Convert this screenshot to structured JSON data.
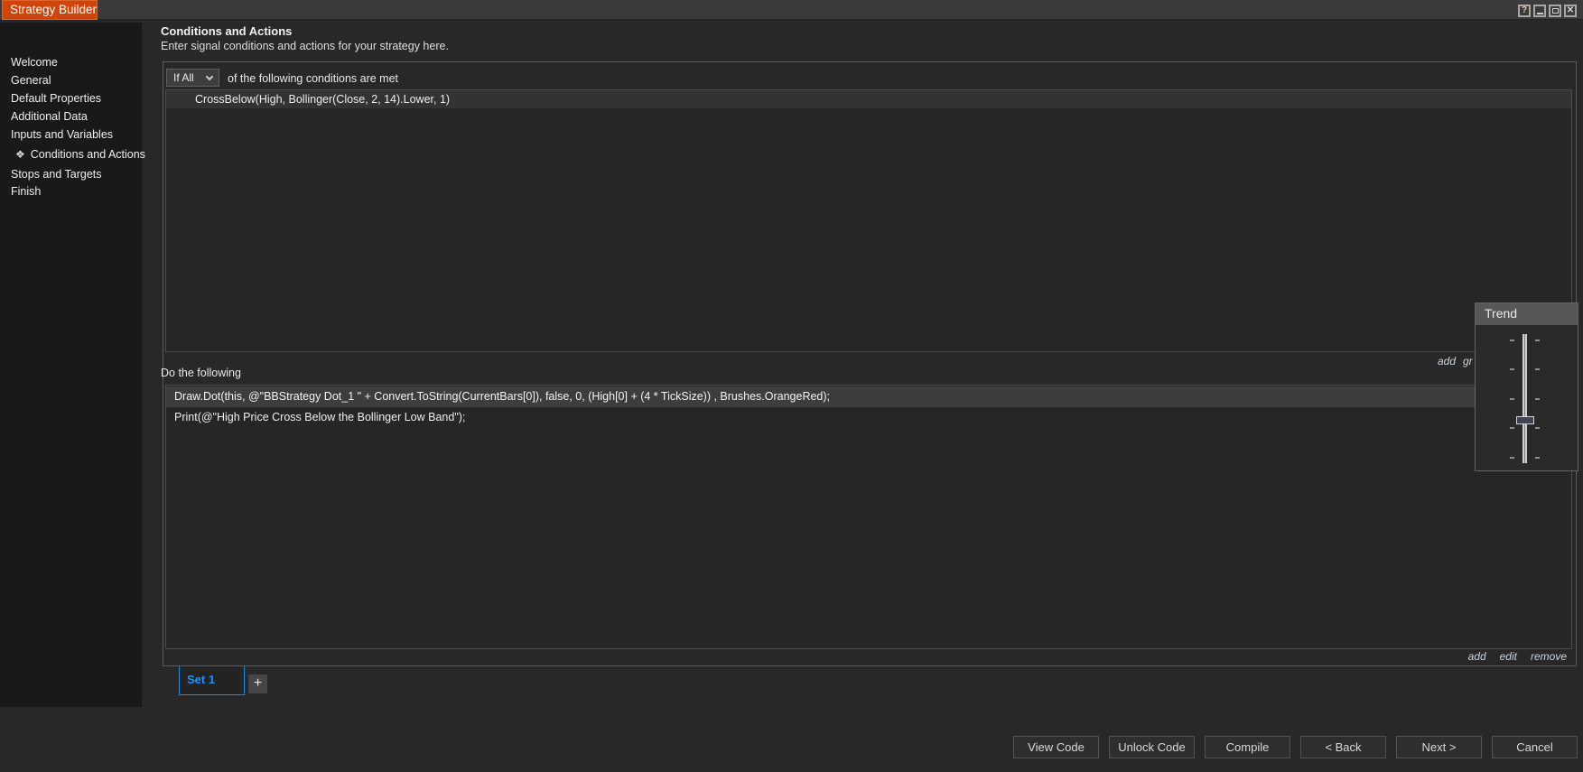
{
  "window": {
    "title": "Strategy Builder",
    "icons": {
      "help": "?",
      "minimize": "—",
      "maximize": "▢",
      "close": "✕"
    }
  },
  "sidebar": {
    "items": [
      {
        "label": "Welcome"
      },
      {
        "label": "General"
      },
      {
        "label": "Default Properties"
      },
      {
        "label": "Additional Data"
      },
      {
        "label": "Inputs and Variables"
      },
      {
        "label": "Conditions and Actions",
        "icon": "❖",
        "selected": true
      },
      {
        "label": "Stops and Targets"
      },
      {
        "label": "Finish"
      }
    ]
  },
  "page": {
    "title": "Conditions and Actions",
    "subtitle": "Enter signal conditions and actions for your strategy here."
  },
  "conditions": {
    "selector_value": "If All",
    "suffix": "of the following conditions are met",
    "items": [
      "CrossBelow(High, Bollinger(Close, 2, 14).Lower, 1)"
    ],
    "links": [
      "add",
      "gr"
    ]
  },
  "actions": {
    "label": "Do the following",
    "items": [
      "Draw.Dot(this, @\"BBStrategy Dot_1 \" + Convert.ToString(CurrentBars[0]), false, 0, (High[0] + (4 * TickSize)) , Brushes.OrangeRed);",
      "Print(@\"High Price Cross Below the Bollinger Low Band\");"
    ],
    "links": [
      "add",
      "edit",
      "remove"
    ]
  },
  "sets": {
    "tabs": [
      "Set 1"
    ],
    "add_label": "+"
  },
  "footer": {
    "buttons": [
      "View Code",
      "Unlock Code",
      "Compile",
      "< Back",
      "Next >",
      "Cancel"
    ]
  },
  "trend": {
    "title": "Trend"
  },
  "colors": {
    "accent_orange": "#ce4409",
    "tab_blue": "#1e90ff",
    "titlebar_bg": "#3b3b3b",
    "sidebar_bg": "#191919",
    "window_bg": "#282828",
    "row_highlight": "#3d3d3d"
  }
}
